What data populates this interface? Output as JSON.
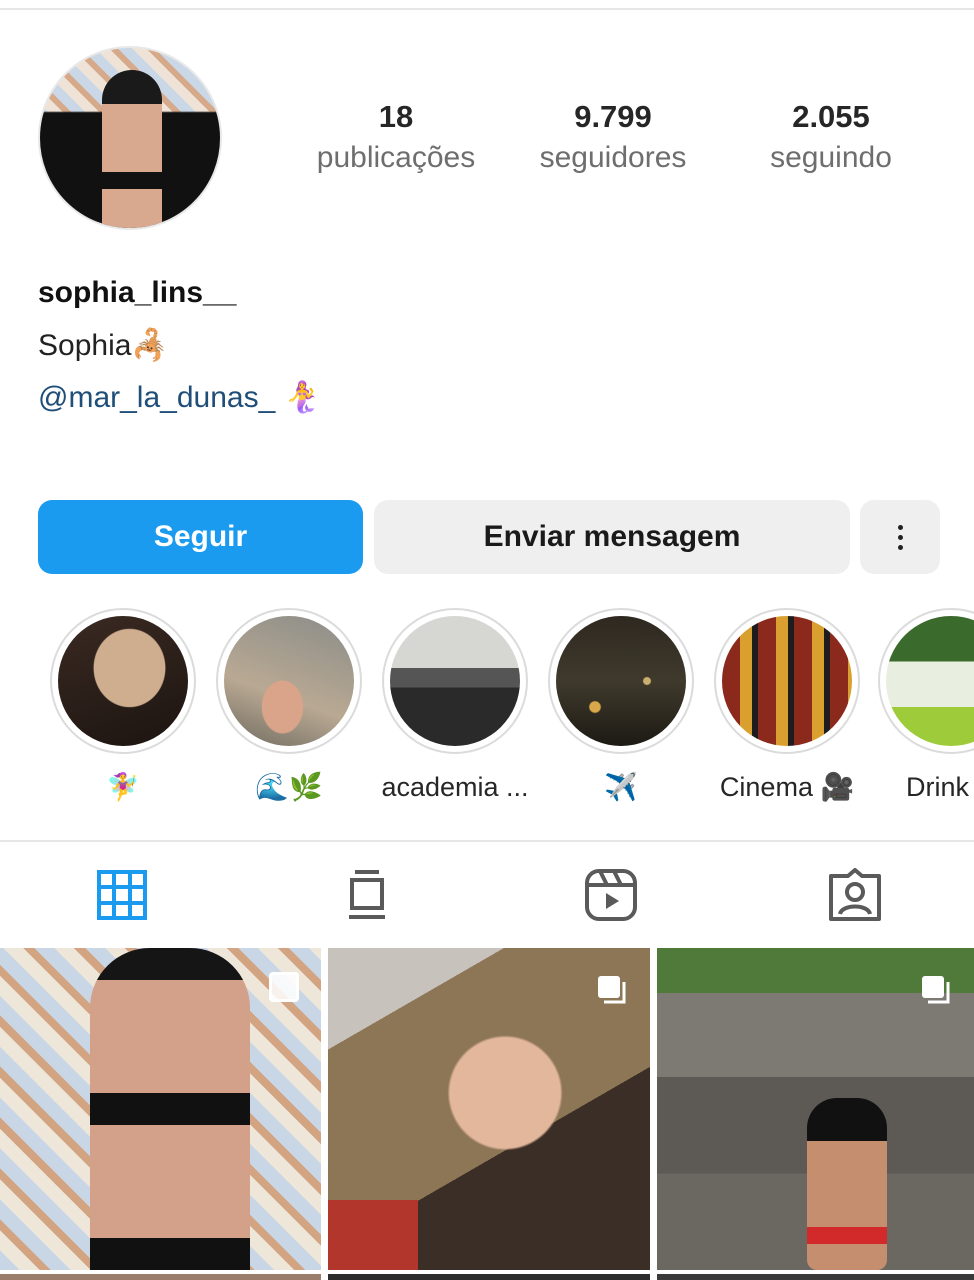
{
  "profile": {
    "username": "sophia_lins__",
    "full_name": "Sophia🦂",
    "mention": "@mar_la_dunas_ 🧜‍♀️"
  },
  "stats": [
    {
      "value": "18",
      "label": "publicações"
    },
    {
      "value": "9.799",
      "label": "seguidores"
    },
    {
      "value": "2.055",
      "label": "seguindo"
    }
  ],
  "actions": {
    "follow": "Seguir",
    "message": "Enviar mensagem"
  },
  "highlights": [
    {
      "label": "🧚‍♀️",
      "icon": "hat-photo"
    },
    {
      "label": "🌊🌿",
      "icon": "crab-photo"
    },
    {
      "label": "academia ...",
      "icon": "gym-photo"
    },
    {
      "label": "✈️",
      "icon": "night-city-photo"
    },
    {
      "label": "Cinema 🎥",
      "icon": "movie-posters-photo"
    },
    {
      "label": "Drink",
      "icon": "drink-photo"
    }
  ],
  "tabs": [
    {
      "name": "posts-grid-icon",
      "active": true
    },
    {
      "name": "feed-icon",
      "active": false
    },
    {
      "name": "reels-icon",
      "active": false
    },
    {
      "name": "tagged-icon",
      "active": false
    }
  ],
  "colors": {
    "accent": "#1a9bf0",
    "mention": "#1f4e79",
    "inactive_icon": "#5a5a5a"
  }
}
